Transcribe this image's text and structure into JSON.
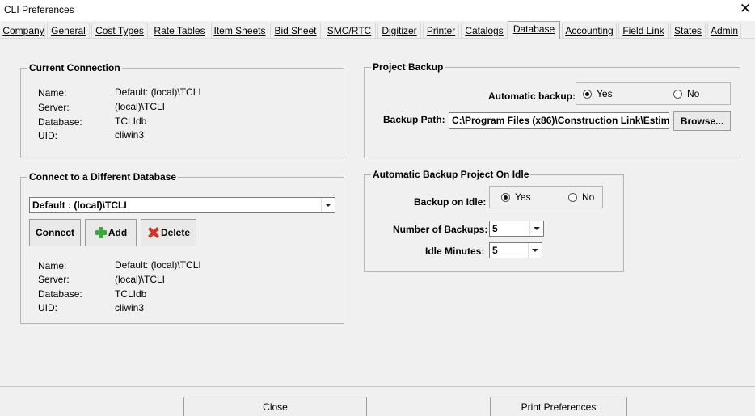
{
  "window": {
    "title": "CLI Preferences",
    "close_glyph": "✕"
  },
  "tabs": [
    "Company",
    "General",
    "Cost Types",
    "Rate Tables",
    "Item Sheets",
    "Bid Sheet",
    "SMC/RTC",
    "Digitizer",
    "Printer",
    "Catalogs",
    "Database",
    "Accounting",
    "Field Link",
    "States",
    "Admin"
  ],
  "active_tab": "Database",
  "current_connection": {
    "title": "Current Connection",
    "labels": {
      "name": "Name:",
      "server": "Server:",
      "database": "Database:",
      "uid": "UID:"
    },
    "values": {
      "name": "Default: (local)\\TCLI",
      "server": "(local)\\TCLI",
      "database": "TCLIdb",
      "uid": "cliwin3"
    }
  },
  "connect_different": {
    "title": "Connect to a Different Database",
    "selected": "Default : (local)\\TCLI",
    "buttons": {
      "connect": "Connect",
      "add": "Add",
      "delete": "Delete"
    },
    "labels": {
      "name": "Name:",
      "server": "Server:",
      "database": "Database:",
      "uid": "UID:"
    },
    "values": {
      "name": "Default: (local)\\TCLI",
      "server": "(local)\\TCLI",
      "database": "TCLIdb",
      "uid": "cliwin3"
    }
  },
  "project_backup": {
    "title": "Project Backup",
    "auto_label": "Automatic backup:",
    "yes": "Yes",
    "no": "No",
    "auto_selected": "Yes",
    "path_label": "Backup Path:",
    "path_value": "C:\\Program Files (x86)\\Construction Link\\Estim",
    "browse": "Browse..."
  },
  "idle_backup": {
    "title": "Automatic Backup Project On Idle",
    "idle_label": "Backup on Idle:",
    "yes": "Yes",
    "no": "No",
    "idle_selected": "Yes",
    "num_label": "Number of Backups:",
    "num_value": "5",
    "minutes_label": "Idle Minutes:",
    "minutes_value": "5"
  },
  "footer": {
    "close": "Close",
    "print": "Print Preferences"
  }
}
